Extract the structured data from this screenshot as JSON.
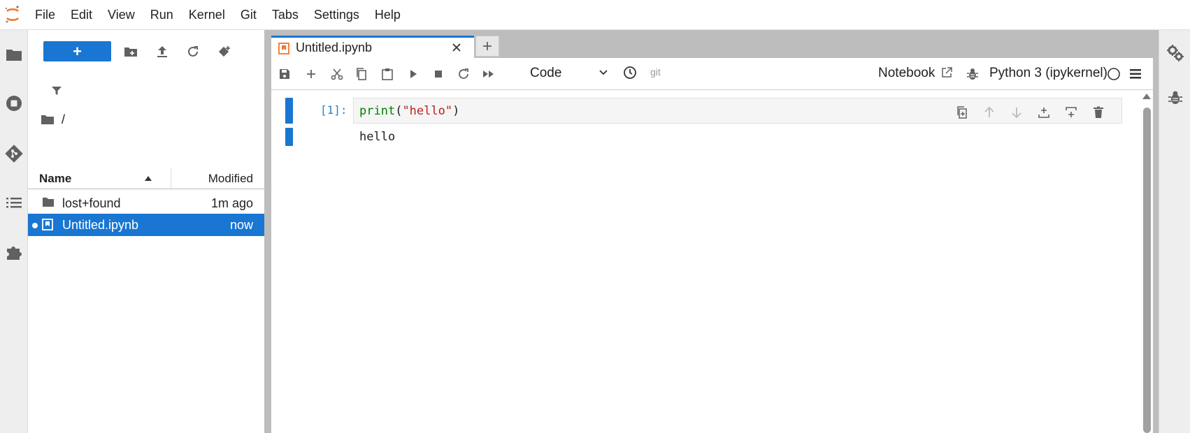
{
  "menubar": {
    "items": [
      "File",
      "Edit",
      "View",
      "Run",
      "Kernel",
      "Git",
      "Tabs",
      "Settings",
      "Help"
    ]
  },
  "left_sidebar": {
    "icons": [
      "folder-icon",
      "running-icon",
      "git-icon",
      "toc-icon",
      "extension-icon"
    ]
  },
  "file_browser": {
    "new_button_icon": "+",
    "breadcrumb": "/",
    "columns": {
      "name": "Name",
      "modified": "Modified"
    },
    "rows": [
      {
        "name": "lost+found",
        "modified": "1m ago",
        "type": "folder",
        "selected": false
      },
      {
        "name": "Untitled.ipynb",
        "modified": "now",
        "type": "notebook",
        "selected": true
      }
    ]
  },
  "tab": {
    "label": "Untitled.ipynb"
  },
  "notebook_toolbar": {
    "cell_type": "Code",
    "git_label": "git",
    "notebook_label": "Notebook",
    "kernel_label": "Python 3 (ipykernel)"
  },
  "cell": {
    "prompt": "[1]:",
    "code_fn": "print",
    "code_open": "(",
    "code_str": "\"hello\"",
    "code_close": ")",
    "output": "hello"
  },
  "colors": {
    "accent": "#1976d2",
    "logo": "#f37726",
    "keyword": "#008000",
    "string": "#ba2121",
    "prompt": "#307fc1"
  }
}
